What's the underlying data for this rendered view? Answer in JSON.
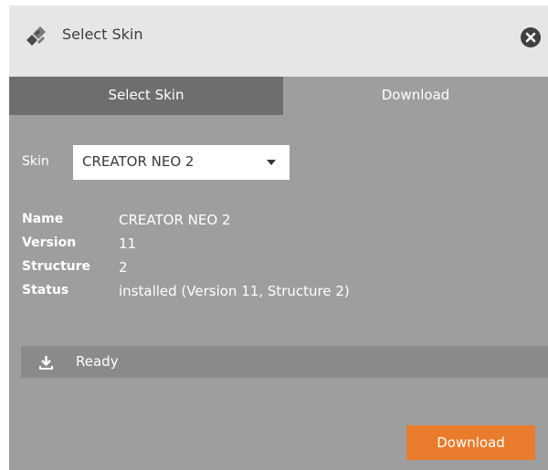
{
  "window": {
    "title": "Select Skin",
    "title_icon": "brush-icon",
    "close_icon": "close-icon"
  },
  "tabs": [
    {
      "label": "Select Skin",
      "active": true
    },
    {
      "label": "Download",
      "active": false
    }
  ],
  "skin": {
    "label": "Skin",
    "selected": "CREATOR NEO 2"
  },
  "info": [
    {
      "key": "Name",
      "value": "CREATOR NEO 2"
    },
    {
      "key": "Version",
      "value": "11"
    },
    {
      "key": "Structure",
      "value": "2"
    },
    {
      "key": "Status",
      "value": "installed (Version 11, Structure 2)"
    }
  ],
  "status_bar": {
    "icon": "download-icon",
    "text": "Ready"
  },
  "download_button": {
    "label": "Download"
  },
  "colors": {
    "dialog_bg": "#9e9e9e",
    "titlebar_bg": "#e6e6e6",
    "active_tab_bg": "#6e6e6e",
    "status_bar_bg": "#8a8a8a",
    "accent_button": "#e87c2c"
  }
}
